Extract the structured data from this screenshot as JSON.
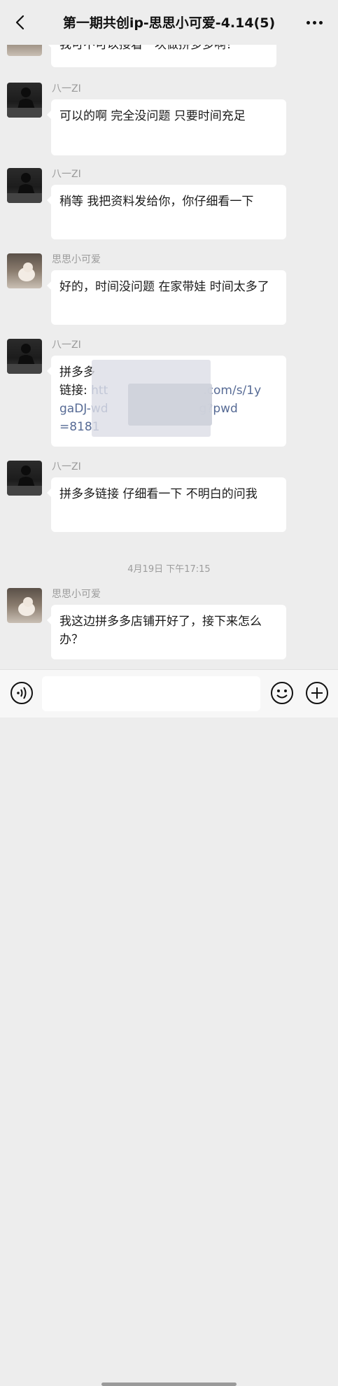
{
  "header": {
    "title": "第一期共创ip-思思小可爱-4.14(5)",
    "back_icon": "chevron-left-icon",
    "more_icon": "more-dots-icon"
  },
  "messages": [
    {
      "sender": "",
      "text": "我可不可以接着一块做拼多多啊？"
    },
    {
      "sender": "八一ZI",
      "text": "可以的啊 完全没问题  只要时间充足"
    },
    {
      "sender": "八一ZI",
      "text": "稍等 我把资料发给你，你仔细看一下"
    },
    {
      "sender": "思思小可爱",
      "text": "好的，时间没问题  在家带娃 时间太多了"
    },
    {
      "sender": "八一ZI",
      "text_prefix": "拼多多",
      "link_label": "链接: ",
      "link_part1": "htt",
      "link_part2": ".com/s/1y",
      "link_part3": "gaDJ-wd",
      "link_part4": "g?pwd",
      "link_part5": "=8181"
    },
    {
      "sender": "八一ZI",
      "text": "拼多多链接 仔细看一下 不明白的问我"
    },
    {
      "sender": "思思小可爱",
      "text": "我这边拼多多店铺开好了，接下来怎么办？"
    }
  ],
  "timestamp": "4月19日 下午17:15",
  "inputbar": {
    "voice_icon": "voice-icon",
    "input_value": "",
    "emoji_icon": "emoji-icon",
    "plus_icon": "plus-icon"
  }
}
